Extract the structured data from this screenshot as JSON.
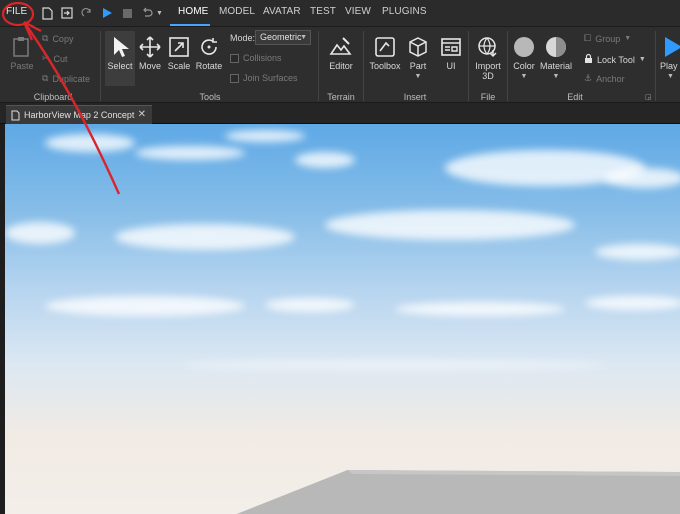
{
  "menubar": {
    "file_label": "FILE",
    "tabs": [
      "HOME",
      "MODEL",
      "AVATAR",
      "TEST",
      "VIEW",
      "PLUGINS"
    ],
    "active_tab": "HOME"
  },
  "ribbon": {
    "clipboard": {
      "paste": "Paste",
      "copy": "Copy",
      "cut": "Cut",
      "duplicate": "Duplicate",
      "label": "Clipboard"
    },
    "tools": {
      "select": "Select",
      "move": "Move",
      "scale": "Scale",
      "rotate": "Rotate",
      "mode_label": "Mode:",
      "mode_value": "Geometric",
      "collisions": "Collisions",
      "join_surfaces": "Join Surfaces",
      "label": "Tools"
    },
    "terrain": {
      "editor": "Editor",
      "label": "Terrain"
    },
    "insert": {
      "toolbox": "Toolbox",
      "part": "Part",
      "ui": "UI",
      "label": "Insert"
    },
    "file": {
      "import_line1": "Import",
      "import_line2": "3D",
      "label": "File"
    },
    "edit": {
      "color": "Color",
      "material": "Material",
      "group": "Group",
      "lock_tool": "Lock Tool",
      "anchor": "Anchor",
      "label": "Edit"
    },
    "test": {
      "play": "Play"
    }
  },
  "document": {
    "tab_title": "HarborView Map 2 Concept",
    "close_glyph": "✕"
  },
  "colors": {
    "accent": "#4aa3ff",
    "annotation": "#d9262b",
    "sky_top": "#5fa9e6"
  }
}
